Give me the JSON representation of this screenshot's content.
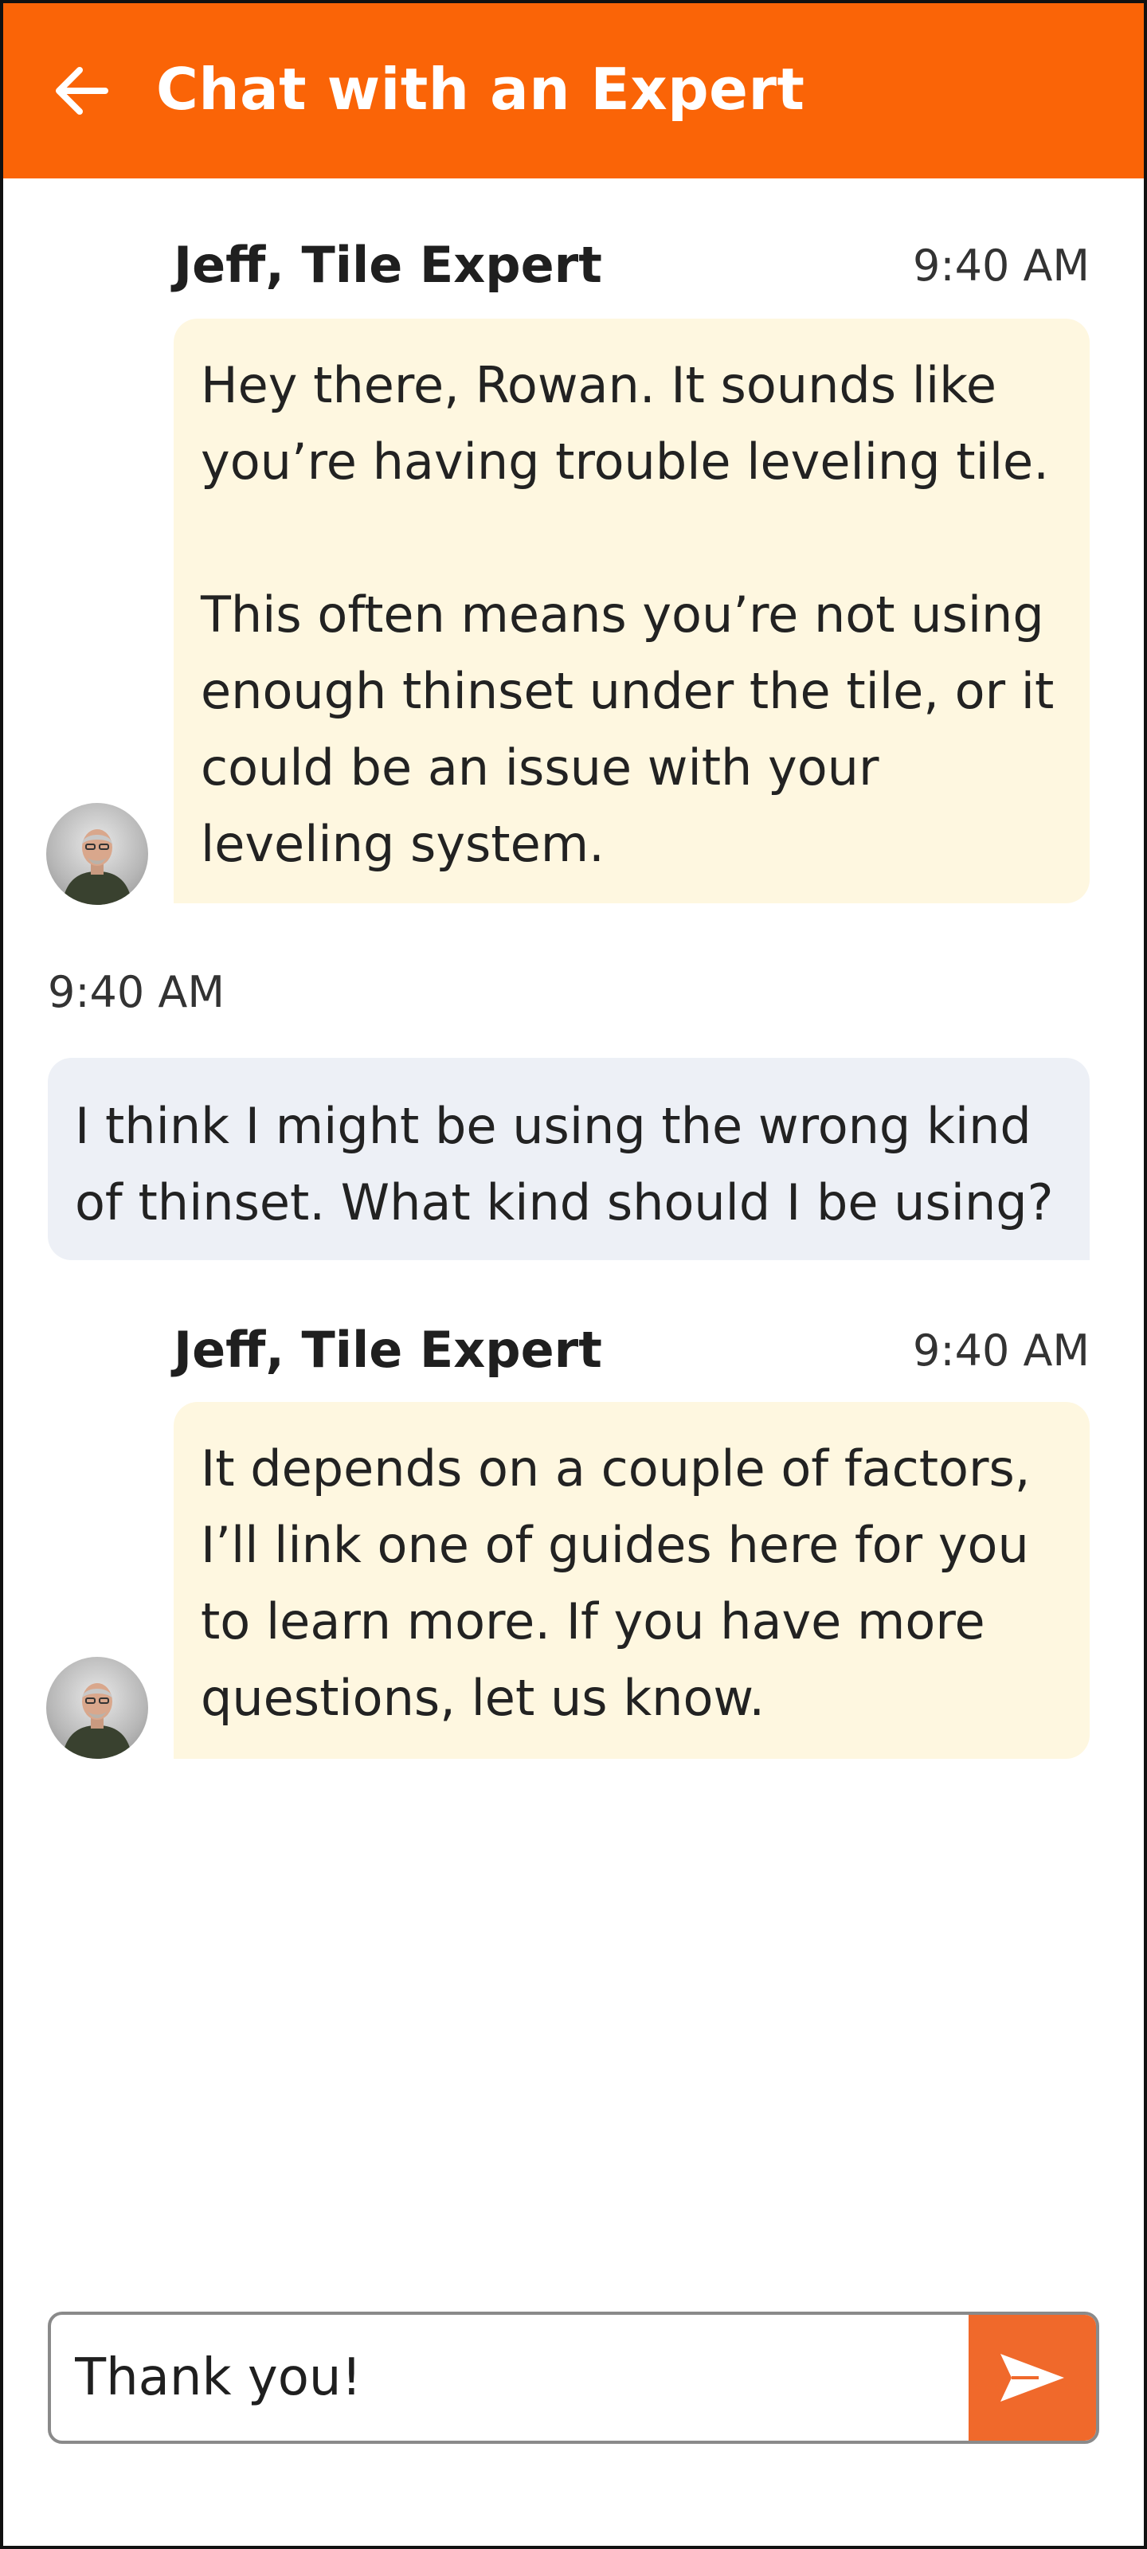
{
  "header": {
    "title": "Chat with an Expert",
    "back_icon": "arrow-left-icon"
  },
  "colors": {
    "accent": "#fa6407",
    "send_button": "#f0692b",
    "expert_bubble": "#fef7e0",
    "user_bubble": "#edf0f6"
  },
  "messages": [
    {
      "sender": "Jeff, Tile Expert",
      "time": "9:40 AM",
      "paragraphs": [
        "Hey there, Rowan. It sounds like you’re having trouble leveling tile.",
        "This often means you’re not using enough thinset under the tile, or it could be an issue with your leveling system."
      ]
    },
    {
      "time": "9:40 AM",
      "text": "I think I might be using the wrong kind of thinset. What kind should I be using?"
    },
    {
      "sender": "Jeff, Tile Expert",
      "time": "9:40 AM",
      "text": "It depends on a couple of factors, I’ll link one of guides here for you to learn more. If you have more questions, let us know."
    }
  ],
  "composer": {
    "value": "Thank you!",
    "send_icon": "send-icon"
  }
}
